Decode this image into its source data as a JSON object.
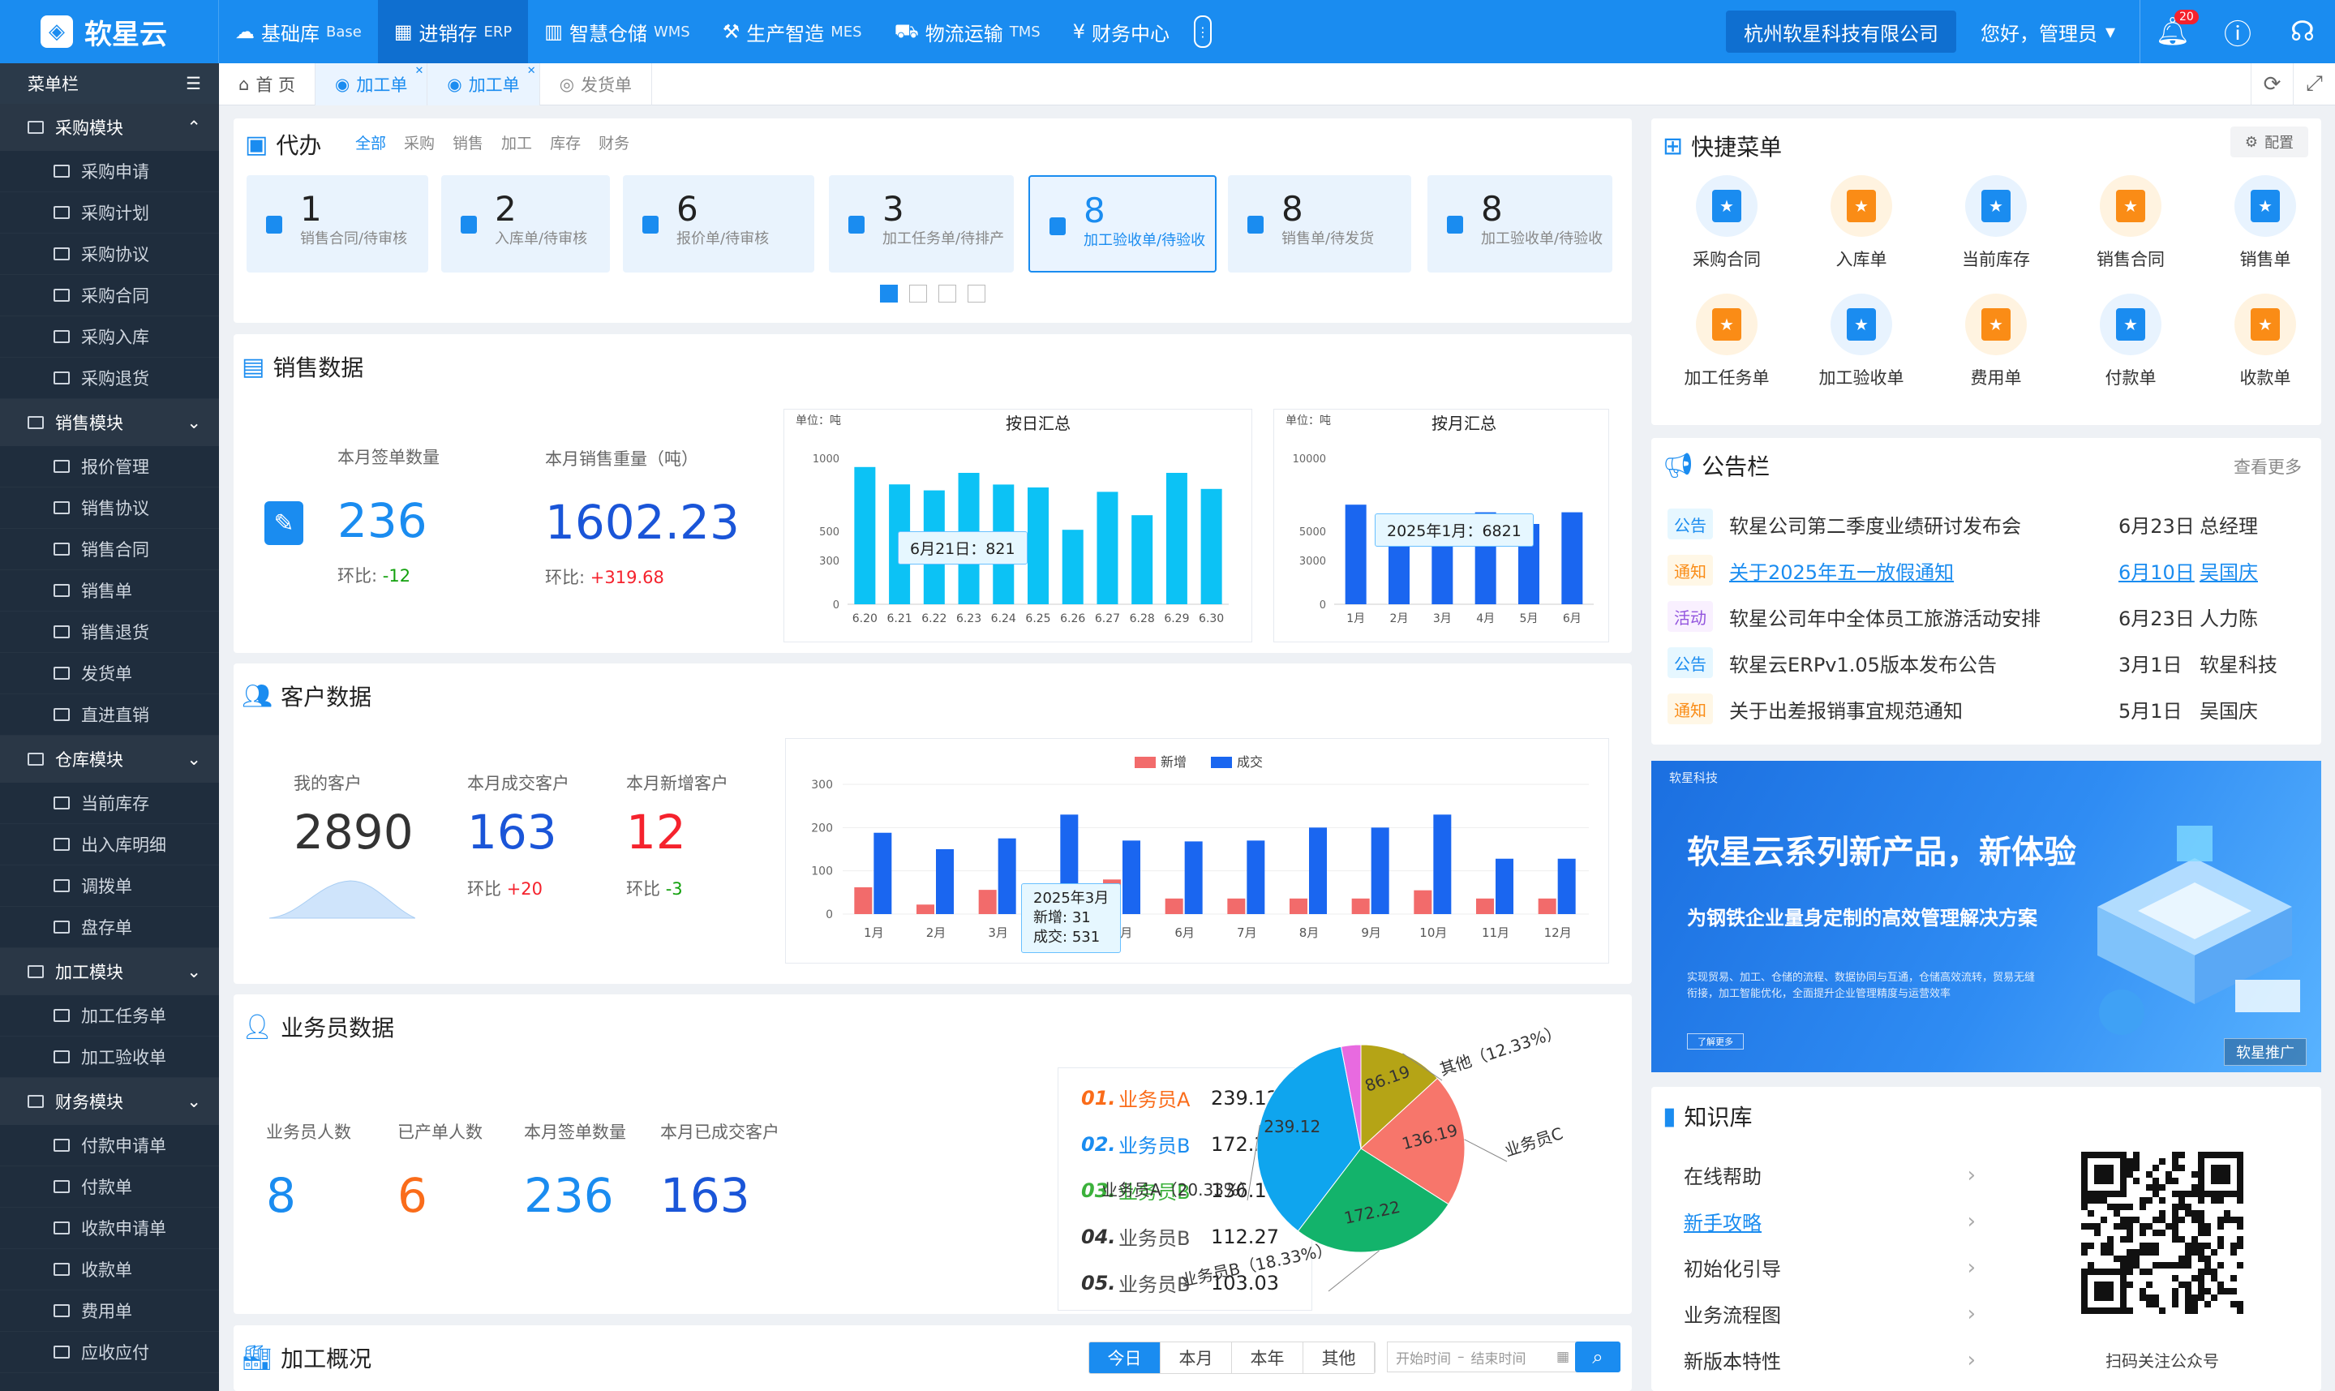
{
  "app": {
    "logo": "软星云"
  },
  "topnav": [
    {
      "label": "基础库",
      "sub": "Base",
      "icon": "cloud-icon"
    },
    {
      "label": "进销存",
      "sub": "ERP",
      "icon": "store-icon"
    },
    {
      "label": "智慧仓储",
      "sub": "WMS",
      "icon": "warehouse-icon"
    },
    {
      "label": "生产智造",
      "sub": "MES",
      "icon": "factory-icon"
    },
    {
      "label": "物流运输",
      "sub": "TMS",
      "icon": "truck-icon"
    },
    {
      "label": "财务中心",
      "sub": "",
      "icon": "yen-icon"
    }
  ],
  "header": {
    "company": "杭州软星科技有限公司",
    "greeting": "您好，管理员",
    "notif_count": "20"
  },
  "sidebar": {
    "title": "菜单栏",
    "groups": [
      {
        "label": "采购模块",
        "items": [
          "采购申请",
          "采购计划",
          "采购协议",
          "采购合同",
          "采购入库",
          "采购退货"
        ]
      },
      {
        "label": "销售模块",
        "items": [
          "报价管理",
          "销售协议",
          "销售合同",
          "销售单",
          "销售退货",
          "发货单",
          "直进直销"
        ]
      },
      {
        "label": "仓库模块",
        "items": [
          "当前库存",
          "出入库明细",
          "调拨单",
          "盘存单"
        ]
      },
      {
        "label": "加工模块",
        "items": [
          "加工任务单",
          "加工验收单"
        ]
      },
      {
        "label": "财务模块",
        "items": [
          "付款申请单",
          "付款单",
          "收款申请单",
          "收款单",
          "费用单",
          "应收应付"
        ]
      }
    ]
  },
  "tabs": [
    "首 页",
    "加工单",
    "加工单",
    "发货单"
  ],
  "todo": {
    "title": "代办",
    "filters": [
      "全部",
      "采购",
      "销售",
      "加工",
      "库存",
      "财务"
    ],
    "cards": [
      {
        "num": "1",
        "label": "销售合同/待审核"
      },
      {
        "num": "2",
        "label": "入库单/待审核"
      },
      {
        "num": "6",
        "label": "报价单/待审核"
      },
      {
        "num": "3",
        "label": "加工任务单/待排产"
      },
      {
        "num": "8",
        "label": "加工验收单/待验收"
      },
      {
        "num": "8",
        "label": "销售单/待发货"
      },
      {
        "num": "8",
        "label": "加工验收单/待验收"
      }
    ]
  },
  "sales": {
    "title": "销售数据",
    "sign_label": "本月签单数量",
    "sign_value": "236",
    "sign_change_label": "环比:",
    "sign_change": "-12",
    "weight_label": "本月销售重量（吨）",
    "weight_value": "1602.23",
    "weight_change_label": "环比:",
    "weight_change": "+319.68"
  },
  "customers": {
    "title": "客户数据",
    "mine_label": "我的客户",
    "mine_value": "2890",
    "deal_label": "本月成交客户",
    "deal_value": "163",
    "deal_change_label": "环比",
    "deal_change": "+20",
    "new_label": "本月新增客户",
    "new_value": "12",
    "new_change_label": "环比",
    "new_change": "-3"
  },
  "staff": {
    "title": "业务员数据",
    "stats": [
      {
        "label": "业务员人数",
        "value": "8"
      },
      {
        "label": "已产单人数",
        "value": "6"
      },
      {
        "label": "本月签单数量",
        "value": "236"
      },
      {
        "label": "本月已成交客户",
        "value": "163"
      }
    ],
    "ranking": [
      {
        "no": "01.",
        "name": "业务员A",
        "value": "239.12"
      },
      {
        "no": "02.",
        "name": "业务员B",
        "value": "172.22"
      },
      {
        "no": "03.",
        "name": "业务员B",
        "value": "136.19"
      },
      {
        "no": "04.",
        "name": "业务员B",
        "value": "112.27"
      },
      {
        "no": "05.",
        "name": "业务员B",
        "value": "103.03"
      }
    ]
  },
  "processing": {
    "title": "加工概况",
    "segments": [
      "今日",
      "本月",
      "本年",
      "其他"
    ],
    "start": "开始时间",
    "end": "结束时间"
  },
  "quickmenu": {
    "title": "快捷菜单",
    "config": "配置",
    "items": [
      "采购合同",
      "入库单",
      "当前库存",
      "销售合同",
      "销售单",
      "加工任务单",
      "加工验收单",
      "费用单",
      "付款单",
      "收款单"
    ]
  },
  "notices": {
    "title": "公告栏",
    "more": "查看更多",
    "rows": [
      {
        "tag": "公告",
        "title": "软星公司第二季度业绩研讨发布会",
        "date": "6月23日",
        "author": "总经理"
      },
      {
        "tag": "通知",
        "title": "关于2025年五一放假通知",
        "date": "6月10日",
        "author": "吴国庆"
      },
      {
        "tag": "活动",
        "title": "软星公司年中全体员工旅游活动安排",
        "date": "6月23日",
        "author": "人力陈"
      },
      {
        "tag": "公告",
        "title": "软星云ERPv1.05版本发布公告",
        "date": "3月1日",
        "author": "软星科技"
      },
      {
        "tag": "通知",
        "title": "关于出差报销事宜规范通知",
        "date": "5月1日",
        "author": "吴国庆"
      }
    ]
  },
  "promo": {
    "brand": "软星科技",
    "headline": "软星云系列新产品，新体验",
    "subhead": "为钢铁企业量身定制的高效管理解决方案",
    "body": "实现贸易、加工、仓储的流程、数据协同与互通，仓储高效流转，贸易无缝衔接，加工智能优化，全面提升企业管理精度与运营效率",
    "more": "了解更多",
    "tag": "软星推广"
  },
  "knowledge": {
    "title": "知识库",
    "items": [
      "在线帮助",
      "新手攻略",
      "初始化引导",
      "业务流程图",
      "新版本特性"
    ],
    "qr_caption": "扫码关注公众号"
  },
  "chart_data": [
    {
      "type": "bar",
      "title": "按日汇总",
      "unit": "单位：吨",
      "categories": [
        "6.20",
        "6.21",
        "6.22",
        "6.23",
        "6.24",
        "6.25",
        "6.26",
        "6.27",
        "6.28",
        "6.29",
        "6.30"
      ],
      "values": [
        940,
        821,
        780,
        900,
        820,
        800,
        510,
        770,
        610,
        900,
        790
      ],
      "ylim": [
        0,
        1000
      ],
      "yticks": [
        0,
        300,
        500,
        1000
      ],
      "tooltip": "6月21日：821",
      "color": "#0cc2f5"
    },
    {
      "type": "bar",
      "title": "按月汇总",
      "unit": "单位：吨",
      "categories": [
        "1月",
        "2月",
        "3月",
        "4月",
        "5月",
        "6月"
      ],
      "values": [
        6821,
        5500,
        5500,
        6300,
        5500,
        6300
      ],
      "ylim": [
        0,
        10000
      ],
      "yticks": [
        0,
        3000,
        5000,
        10000
      ],
      "tooltip": "2025年1月：6821",
      "color": "#1a66f0"
    },
    {
      "type": "bar",
      "categories": [
        "1月",
        "2月",
        "3月",
        "4月",
        "5月",
        "6月",
        "7月",
        "8月",
        "9月",
        "10月",
        "11月",
        "12月"
      ],
      "series": [
        {
          "name": "新增",
          "color": "#f26b6b",
          "values": [
            62,
            22,
            56,
            40,
            80,
            36,
            36,
            36,
            36,
            55,
            36,
            36
          ]
        },
        {
          "name": "成交",
          "color": "#1a66f0",
          "values": [
            188,
            150,
            175,
            230,
            170,
            168,
            170,
            200,
            200,
            230,
            128,
            128
          ]
        }
      ],
      "ylim": [
        0,
        300
      ],
      "yticks": [
        0,
        100,
        200,
        300
      ],
      "tooltip": {
        "title": "2025年3月",
        "new_label": "新增:",
        "new_value": "31",
        "deal_label": "成交:",
        "deal_value": "531"
      }
    },
    {
      "type": "pie",
      "slices": [
        {
          "name": "业务员A",
          "value": 239.12,
          "pct": "20.33%",
          "color": "#0fa5ee"
        },
        {
          "name": "业务员B",
          "value": 172.22,
          "pct": "18.33%",
          "color": "#13b36b"
        },
        {
          "name": "业务员C",
          "value": 136.19,
          "pct": "12.33%",
          "color": "#f7766b"
        },
        {
          "name": "其他",
          "value": 86.19,
          "pct": "12.33%",
          "color": "#b5a416"
        },
        {
          "name": "",
          "value": 20,
          "pct": "",
          "color": "#e86ae0"
        }
      ]
    }
  ]
}
